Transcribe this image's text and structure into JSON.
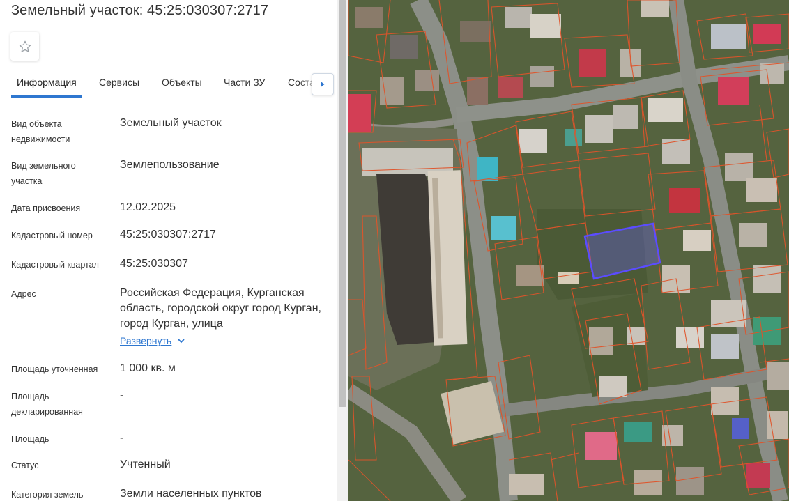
{
  "page": {
    "title": "Земельный участок: 45:25:030307:2717"
  },
  "icons": {
    "favorite": "star-outline-icon",
    "tabs_next": "caret-right-icon",
    "expand": "chevron-down-icon"
  },
  "tabs": [
    {
      "label": "Информация",
      "active": true
    },
    {
      "label": "Сервисы",
      "active": false
    },
    {
      "label": "Объекты",
      "active": false
    },
    {
      "label": "Части ЗУ",
      "active": false
    },
    {
      "label": "Соста",
      "active": false
    }
  ],
  "details": {
    "object_type": {
      "label": "Вид объекта недвижимости",
      "value": "Земельный участок"
    },
    "land_type": {
      "label": "Вид земельного участка",
      "value": "Землепользование"
    },
    "assign_date": {
      "label": "Дата присвоения",
      "value": "12.02.2025"
    },
    "cadastral_number": {
      "label": "Кадастровый номер",
      "value": "45:25:030307:2717"
    },
    "cadastral_quarter": {
      "label": "Кадастровый квартал",
      "value": "45:25:030307"
    },
    "address": {
      "label": "Адрес",
      "value": "Российская Федерация, Курганская область, городской округ город Курган, город Курган, улица",
      "expand_label": "Развернуть"
    },
    "area_specified": {
      "label": "Площадь уточненная",
      "value": "1 000 кв. м"
    },
    "area_declared": {
      "label": "Площадь декларированная",
      "value": "-"
    },
    "area": {
      "label": "Площадь",
      "value": "-"
    },
    "status": {
      "label": "Статус",
      "value": "Учтенный"
    },
    "land_category": {
      "label": "Категория земель",
      "value": "Земли населенных пунктов"
    }
  },
  "colors": {
    "accent": "#2e77d0",
    "selected_parcel": "#5b4cff",
    "parcel_borders": "#e0542a"
  }
}
